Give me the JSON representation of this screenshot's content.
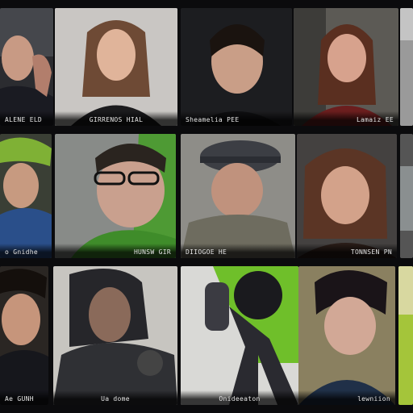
{
  "tiles": [
    {
      "caption": "ALENE ELD"
    },
    {
      "caption": "GIRRENOS HIAL"
    },
    {
      "caption": "Sheamelia PEE"
    },
    {
      "caption": "Lamaiz EE"
    },
    {
      "caption": "o Gnidhe"
    },
    {
      "caption": "HUNSW GIR"
    },
    {
      "caption": "DIIOGOE HE"
    },
    {
      "caption": "TONNSEN PN"
    },
    {
      "caption": "Ae GUNH"
    },
    {
      "caption": "Ua dome"
    },
    {
      "caption": "Onideeaton"
    },
    {
      "caption": "lewniion"
    }
  ],
  "colors": {
    "background": "#0b0b0d",
    "accent_green": "#6fbf2a"
  }
}
